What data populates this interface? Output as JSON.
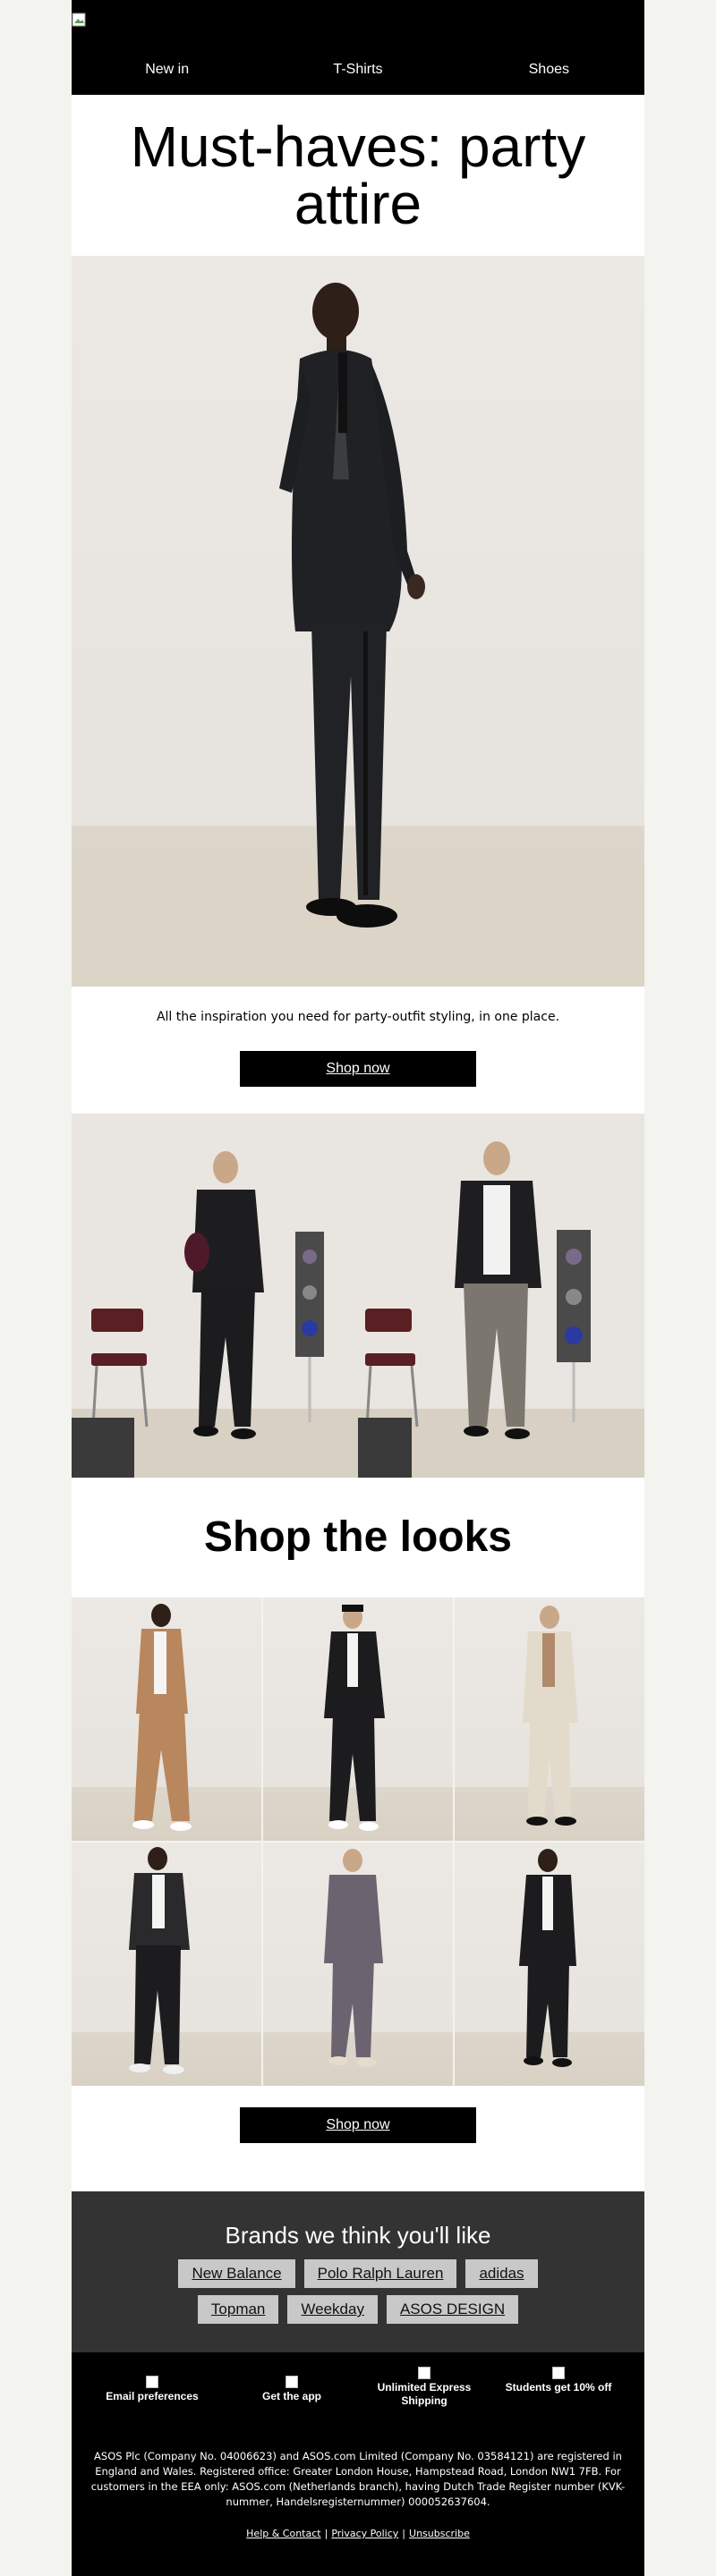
{
  "header": {
    "nav": [
      "New in",
      "T-Shirts",
      "Shoes"
    ]
  },
  "hero": {
    "title": "Must-haves: party attire"
  },
  "intro": {
    "text": "All the inspiration you need for party-outfit styling, in one place.",
    "button": "Shop now"
  },
  "looks": {
    "title": "Shop the looks",
    "button": "Shop now"
  },
  "brands": {
    "title": "Brands we think you'll like",
    "row1": [
      "New Balance",
      "Polo Ralph Lauren",
      "adidas"
    ],
    "row2": [
      "Topman",
      "Weekday",
      "ASOS DESIGN"
    ]
  },
  "footer": {
    "features": [
      {
        "label": "Email preferences"
      },
      {
        "label": "Get the app"
      },
      {
        "label": "Unlimited Express Shipping"
      },
      {
        "label": "Students get 10% off"
      }
    ],
    "legal": "ASOS Plc (Company No. 04006623) and ASOS.com Limited (Company No. 03584121) are registered in England and Wales. Registered office: Greater London House, Hampstead Road, London NW1 7FB. For customers in the EEA only: ASOS.com (Netherlands branch), having Dutch Trade Register number (KVK-nummer, Handelsregisternummer) 000052637604.",
    "links": [
      "Help & Contact",
      "Privacy Policy",
      "Unsubscribe"
    ]
  },
  "colors": {
    "header_bg": "#000000",
    "brands_bg": "#333333",
    "pill_bg": "#c8c8c8",
    "page_bg": "#f3f3ef"
  }
}
